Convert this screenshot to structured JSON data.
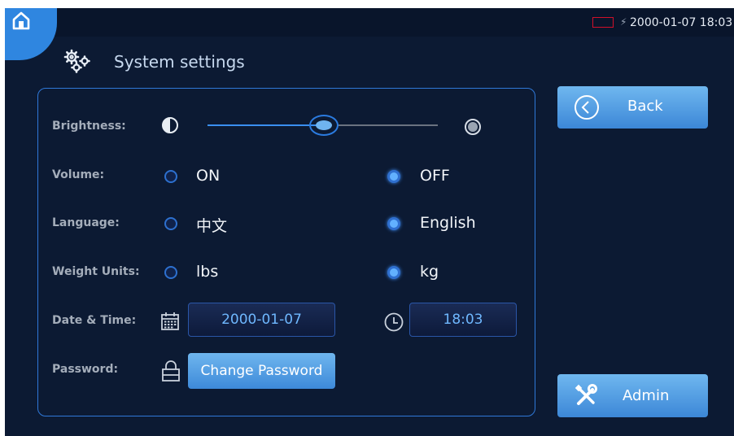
{
  "status_bar": {
    "charging_symbol": "⚡",
    "datetime": "2000-01-07 18:03"
  },
  "header": {
    "title": "System settings"
  },
  "settings": {
    "brightness": {
      "label": "Brightness:",
      "level_fraction": 0.52
    },
    "volume": {
      "label": "Volume:",
      "options": [
        "ON",
        "OFF"
      ],
      "selected": "OFF"
    },
    "language": {
      "label": "Language:",
      "options": [
        "中文",
        "English"
      ],
      "selected": "English"
    },
    "weight_units": {
      "label": "Weight Units:",
      "options": [
        "lbs",
        "kg"
      ],
      "selected": "kg"
    },
    "date_time": {
      "label": "Date & Time:",
      "date": "2000-01-07",
      "time": "18:03"
    },
    "password": {
      "label": "Password:",
      "button": "Change Password"
    }
  },
  "side": {
    "back": "Back",
    "admin": "Admin"
  },
  "colors": {
    "background": "#0c1a33",
    "accent": "#2f86e0",
    "radio_selected": "#62b1ff",
    "battery_border": "#d0102a"
  },
  "icons": [
    "home-icon",
    "gear-icon",
    "brightness-low-icon",
    "brightness-high-icon",
    "calendar-icon",
    "clock-icon",
    "lock-icon",
    "back-arrow-icon",
    "tools-icon"
  ]
}
